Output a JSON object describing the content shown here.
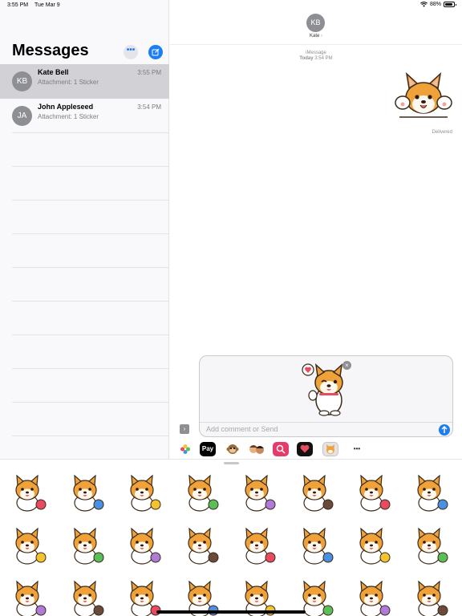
{
  "status_bar": {
    "time": "3:55 PM",
    "date": "Tue Mar 9",
    "battery": "88%"
  },
  "sidebar": {
    "title": "Messages",
    "more_icon": "ellipsis-icon",
    "compose_icon": "compose-icon",
    "conversations": [
      {
        "initials": "KB",
        "name": "Kate Bell",
        "preview": "Attachment: 1 Sticker",
        "time": "3:55 PM",
        "selected": true
      },
      {
        "initials": "JA",
        "name": "John Appleseed",
        "preview": "Attachment: 1 Sticker",
        "time": "3:54 PM",
        "selected": false
      }
    ]
  },
  "chat": {
    "contact_initials": "KB",
    "contact_name": "Kate",
    "chevron": "›",
    "service_label": "iMessage",
    "timestamp_prefix": "Today",
    "timestamp_time": "3:54 PM",
    "delivered_label": "Delivered",
    "sent_sticker": "shiba-waving-paws-sticker"
  },
  "compose": {
    "placeholder": "Add comment or Send",
    "staged_sticker": "shiba-love-heart-sticker",
    "remove_label": "×",
    "app_button_label": "›"
  },
  "app_tray": [
    {
      "name": "photos-app-icon",
      "label": ""
    },
    {
      "name": "apple-pay-icon",
      "label": "Pay"
    },
    {
      "name": "monkey-emoji-icon",
      "label": ""
    },
    {
      "name": "memoji-icon",
      "label": ""
    },
    {
      "name": "search-images-icon",
      "label": ""
    },
    {
      "name": "digital-touch-icon",
      "label": ""
    },
    {
      "name": "shiba-sticker-app-icon",
      "label": ""
    },
    {
      "name": "more-apps-icon",
      "label": "•••"
    }
  ],
  "stickers": [
    "shiba-love-heart",
    "shiba-waving-paws",
    "shiba-pizza",
    "shiba-laptop",
    "shiba-sushi-roll",
    "shiba-ramen-chopsticks",
    "shiba-noodle-bowl",
    "shiba-swim-ring-sunglasses",
    "shiba-heart-sitting",
    "shiba-rocket",
    "shiba-box-heart",
    "shiba-lying",
    "shiba-box-peek",
    "shiba-lying-front",
    "shiba-balloon",
    "shiba-float-ring",
    "shiba-bathtub",
    "shiba-bow-tie",
    "shiba-burger",
    "shiba-mask",
    "shiba-bone",
    "shiba-sushi",
    "shiba-reading-book",
    "shiba-bottle"
  ]
}
